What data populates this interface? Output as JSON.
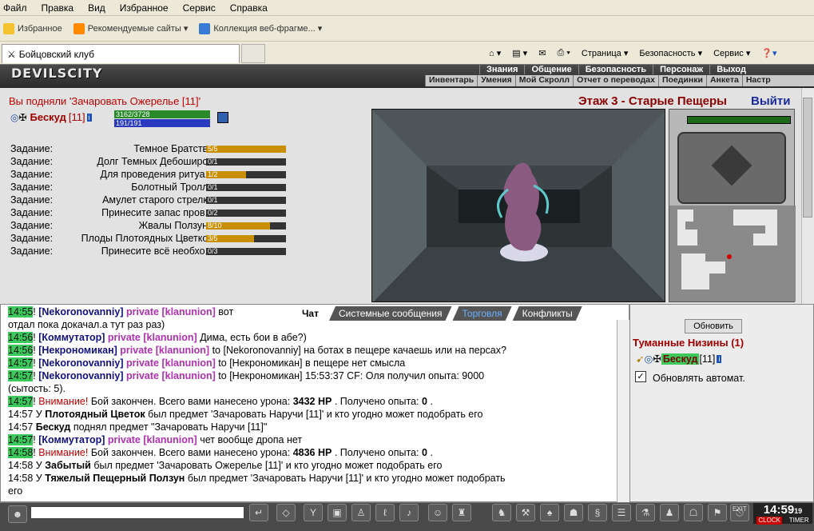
{
  "browser": {
    "menu": [
      "Файл",
      "Правка",
      "Вид",
      "Избранное",
      "Сервис",
      "Справка"
    ],
    "favorites_label": "Избранное",
    "fav_links": [
      "Рекомендуемые сайты ▾",
      "Коллекция веб-фрагме... ▾"
    ],
    "tab_title": "Бойцовский клуб",
    "cmd": [
      "Страница ▾",
      "Безопасность ▾",
      "Сервис ▾"
    ]
  },
  "game": {
    "logo": "DEVILSCITY",
    "nav_top": [
      "Знания",
      "Общение",
      "Безопасность",
      "Персонаж",
      "Выход"
    ],
    "nav_sub": [
      "Инвентарь",
      "Умения",
      "Мой Скролл",
      "Отчет о переводах",
      "Поединки",
      "Анкета",
      "Настр"
    ],
    "pickup_msg": "Вы подняли 'Зачаровать Ожерелье [11]'",
    "floor_title": "Этаж 3 - Старые Пещеры",
    "exit_label": "Выйти",
    "player": {
      "name": "Бескуд",
      "level": "[11]",
      "hp": "3162/3728",
      "mp": "191/191"
    },
    "quest_label": "Задание:",
    "quests": [
      {
        "name": "Темное Братство",
        "progress": "5/5",
        "fill": 1.0
      },
      {
        "name": "Долг Темных Дебоширов",
        "progress": "0/1",
        "fill": 0
      },
      {
        "name": "Для проведения ритуа...",
        "progress": "1/2",
        "fill": 0.5
      },
      {
        "name": "Болотный Тролль",
        "progress": "0/1",
        "fill": 0
      },
      {
        "name": "Амулет старого стрелка",
        "progress": "0/1",
        "fill": 0
      },
      {
        "name": "Принесите запас пров...",
        "progress": "0/2",
        "fill": 0
      },
      {
        "name": "Жвалы Ползуна",
        "progress": "8/10",
        "fill": 0.8
      },
      {
        "name": "Плоды Плотоядных Цветков",
        "progress": "3/5",
        "fill": 0.6
      },
      {
        "name": "Принесите всё необхо...",
        "progress": "0/3",
        "fill": 0
      }
    ]
  },
  "chat": {
    "tabs": [
      "Чат",
      "Системные сообщения",
      "Торговля",
      "Конфликты"
    ],
    "lines": [
      {
        "t": "14:55",
        "parts": [
          [
            "nk",
            "[Nekoronovanniy]"
          ],
          [
            "pv",
            " private [klanunion]"
          ],
          [
            "",
            "вот"
          ]
        ]
      },
      {
        "t": "",
        "parts": [
          [
            "",
            "отдал пока докачал.а тут раз раз)"
          ]
        ]
      },
      {
        "t": "14:56",
        "parts": [
          [
            "nk",
            "[Коммутатор]"
          ],
          [
            "pv",
            " private [klanunion]"
          ],
          [
            "",
            "Дима, есть бои в абе?)"
          ]
        ]
      },
      {
        "t": "14:56",
        "parts": [
          [
            "nk",
            "[Некрономикан]"
          ],
          [
            "pv",
            " private [klanunion]"
          ],
          [
            "",
            "to [Nekoronovanniy] на ботах в пещере качаешь или на персах?"
          ]
        ]
      },
      {
        "t": "14:57",
        "parts": [
          [
            "nk",
            "[Nekoronovanniy]"
          ],
          [
            "pv",
            " private [klanunion]"
          ],
          [
            "",
            "to [Некрономикан] в пещере нет смысла"
          ]
        ]
      },
      {
        "t": "14:57",
        "parts": [
          [
            "nk",
            "[Nekoronovanniy]"
          ],
          [
            "pv",
            " private [klanunion]"
          ],
          [
            "",
            "to [Некрономикан] 15:53:37 CF: Оля получил опыта: 9000"
          ]
        ]
      },
      {
        "t": "",
        "parts": [
          [
            "",
            "(сытость: 5)."
          ]
        ]
      },
      {
        "t": "14:57",
        "parts": [
          [
            "warn",
            "Внимание!"
          ],
          [
            "",
            "Бой закончен. Всего вами нанесено урона:"
          ],
          [
            "b",
            "3432 HP"
          ],
          [
            "",
            ". Получено опыта:"
          ],
          [
            "b",
            "0"
          ],
          [
            "",
            "."
          ]
        ]
      },
      {
        "t": "14:57",
        "plain": true,
        "parts": [
          [
            "",
            "У"
          ],
          [
            "b",
            "Плотоядный Цветок"
          ],
          [
            "",
            "был предмет 'Зачаровать Наручи [11]' и кто угодно может подобрать его"
          ]
        ]
      },
      {
        "t": "14:57",
        "plain": true,
        "parts": [
          [
            "b",
            "Бескуд"
          ],
          [
            "",
            "поднял предмет \"Зачаровать Наручи [11]\""
          ]
        ]
      },
      {
        "t": "14:57",
        "parts": [
          [
            "nk",
            "[Коммутатор]"
          ],
          [
            "pv",
            " private [klanunion]"
          ],
          [
            "",
            "чет вообще дропа нет"
          ]
        ]
      },
      {
        "t": "14:58",
        "parts": [
          [
            "warn",
            "Внимание!"
          ],
          [
            "",
            "Бой закончен. Всего вами нанесено урона:"
          ],
          [
            "b",
            "4836 HP"
          ],
          [
            "",
            ". Получено опыта:"
          ],
          [
            "b",
            "0"
          ],
          [
            "",
            "."
          ]
        ]
      },
      {
        "t": "14:58",
        "plain": true,
        "parts": [
          [
            "",
            "У"
          ],
          [
            "b",
            "Забытый"
          ],
          [
            "",
            "был предмет 'Зачаровать Ожерелье [11]' и кто угодно может подобрать его"
          ]
        ]
      },
      {
        "t": "14:58",
        "plain": true,
        "parts": [
          [
            "",
            "У"
          ],
          [
            "b",
            "Тяжелый Пещерный Ползун"
          ],
          [
            "",
            "был предмет 'Зачаровать Наручи [11]' и кто угодно может подобрать"
          ]
        ]
      },
      {
        "t": "",
        "parts": [
          [
            "",
            "его"
          ]
        ]
      }
    ]
  },
  "online": {
    "refresh": "Обновить",
    "location": "Туманные Низины (1)",
    "user": "Бескуд",
    "level": "[11]",
    "auto": "Обновлять автомат."
  },
  "bottom": {
    "time": "14:59",
    "sec": "19",
    "clock": "CLOCK",
    "timer": "TIMER",
    "exit": "EXIT"
  }
}
